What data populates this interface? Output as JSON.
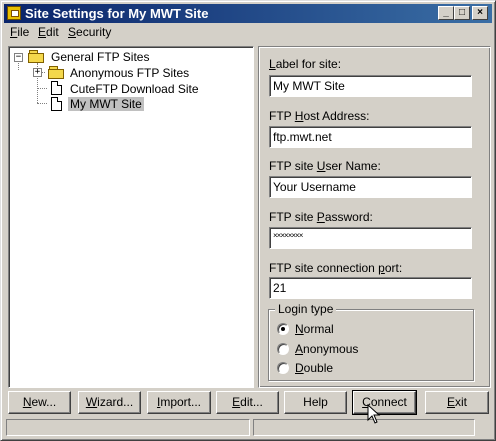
{
  "window": {
    "title": "Site Settings for My MWT Site",
    "controls": {
      "minimize": "_",
      "maximize": "□",
      "close": "×"
    }
  },
  "menu": [
    {
      "label": "File",
      "hotkey": "F",
      "rest": "ile"
    },
    {
      "label": "Edit",
      "hotkey": "E",
      "rest": "dit"
    },
    {
      "label": "Security",
      "hotkey": "S",
      "rest": "ecurity"
    }
  ],
  "tree": {
    "root": {
      "label": "General FTP Sites",
      "expander": "−",
      "icon": "folder-open-icon"
    },
    "children": [
      {
        "label": "Anonymous FTP Sites",
        "expander": "+",
        "icon": "folder-icon"
      },
      {
        "label": "CuteFTP Download Site",
        "icon": "document-icon"
      },
      {
        "label": "My MWT Site",
        "icon": "document-icon",
        "selected": true
      }
    ]
  },
  "form": {
    "label_for_site": {
      "pre": "",
      "hot": "L",
      "post": "abel for site:",
      "value": "My MWT Site"
    },
    "host_address": {
      "pre": "FTP ",
      "hot": "H",
      "post": "ost Address:",
      "value": "ftp.mwt.net"
    },
    "user_name": {
      "pre": "FTP site ",
      "hot": "U",
      "post": "ser Name:",
      "value": "Your Username"
    },
    "password": {
      "pre": "FTP site ",
      "hot": "P",
      "post": "assword:",
      "value": "××××××××"
    },
    "port": {
      "pre": "FTP site connection ",
      "hot": "p",
      "post": "ort:",
      "value": "21"
    }
  },
  "login_type": {
    "legend": "Login type",
    "options": [
      {
        "pre": "",
        "hot": "N",
        "post": "ormal",
        "checked": true
      },
      {
        "pre": "",
        "hot": "A",
        "post": "nonymous",
        "checked": false
      },
      {
        "pre": "",
        "hot": "D",
        "post": "ouble",
        "checked": false
      }
    ]
  },
  "buttons": {
    "new": {
      "hot": "N",
      "post": "ew..."
    },
    "wizard": {
      "hot": "W",
      "post": "izard..."
    },
    "import": {
      "hot": "I",
      "post": "mport..."
    },
    "edit": {
      "hot": "E",
      "post": "dit..."
    },
    "help": {
      "hot": "",
      "post": "Help"
    },
    "connect": {
      "hot": "C",
      "post": "onnect"
    },
    "exit": {
      "hot": "E",
      "post": "xit"
    }
  }
}
